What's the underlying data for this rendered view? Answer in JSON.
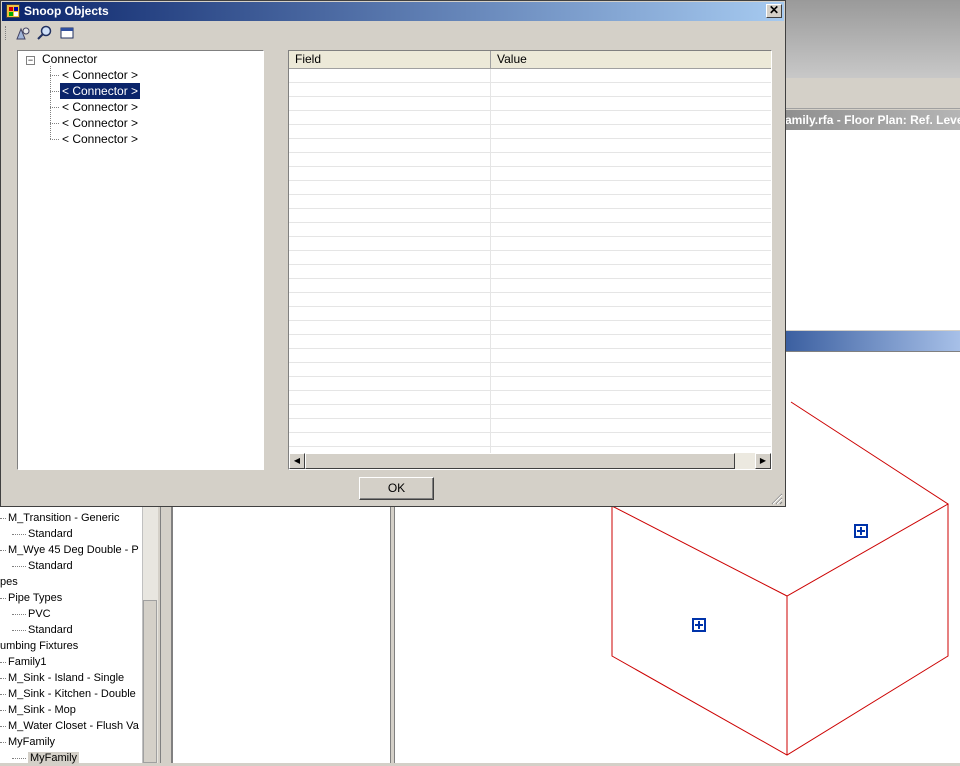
{
  "dialog": {
    "title": "Snoop Objects",
    "close_glyph": "✕",
    "ok_label": "OK"
  },
  "toolbar": {
    "buttons": [
      "snoop-icon",
      "find-icon",
      "window-icon"
    ]
  },
  "tree": {
    "root": "Connector",
    "toggle": "−",
    "children": [
      "< Connector >",
      "< Connector >",
      "< Connector >",
      "< Connector >",
      "< Connector >"
    ],
    "selected_index": 1
  },
  "grid": {
    "columns": [
      "Field",
      "Value"
    ],
    "rows": []
  },
  "background": {
    "view1_title": "amily.rfa - Floor Plan: Ref. Level",
    "browser_items": [
      {
        "text": "M_Transition - Generic",
        "indent": 1
      },
      {
        "text": "Standard",
        "indent": 2
      },
      {
        "text": "M_Wye 45 Deg Double - P",
        "indent": 1
      },
      {
        "text": "Standard",
        "indent": 2
      },
      {
        "text": "pes",
        "indent": 0
      },
      {
        "text": "Pipe Types",
        "indent": 1
      },
      {
        "text": "PVC",
        "indent": 2
      },
      {
        "text": "Standard",
        "indent": 2
      },
      {
        "text": "umbing Fixtures",
        "indent": 0
      },
      {
        "text": "Family1",
        "indent": 1
      },
      {
        "text": "M_Sink - Island - Single",
        "indent": 1
      },
      {
        "text": "M_Sink - Kitchen - Double",
        "indent": 1
      },
      {
        "text": "M_Sink - Mop",
        "indent": 1
      },
      {
        "text": "M_Water Closet - Flush Va",
        "indent": 1
      },
      {
        "text": "MyFamily",
        "indent": 1
      },
      {
        "text": "MyFamily",
        "indent": 2,
        "selected": true
      }
    ],
    "colors": {
      "model_lines": "#cc0000",
      "connector_icon": "#0033aa"
    }
  }
}
